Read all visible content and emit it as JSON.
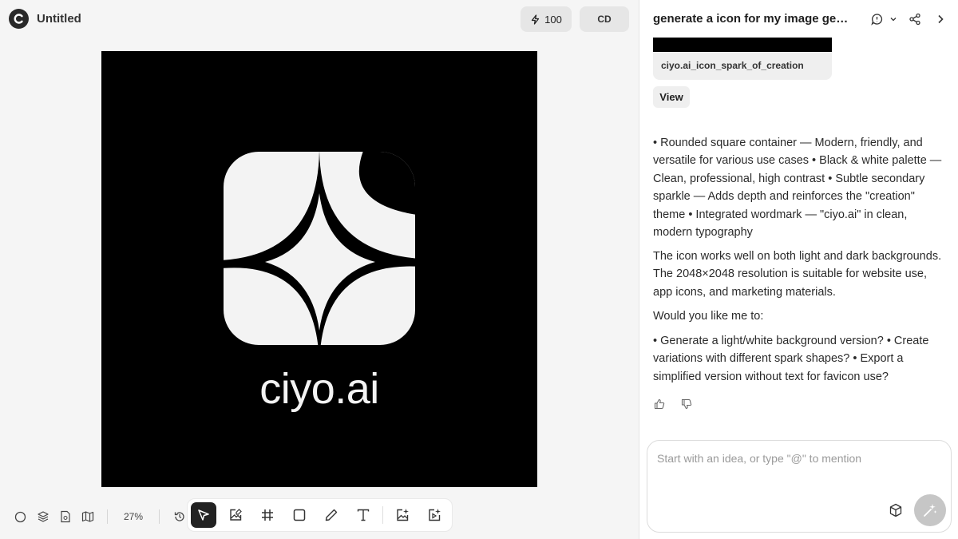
{
  "app": {
    "document_title": "Untitled",
    "credits": "100",
    "user_initials": "CD"
  },
  "canvas": {
    "artwork": {
      "wordmark": "ciyo.ai",
      "background_color": "#000000",
      "foreground_color": "#f3f3f3"
    },
    "zoom": "27%"
  },
  "bottom_left_tools": [
    "circle-icon",
    "layers-icon",
    "page-icon",
    "map-icon"
  ],
  "toolbar": {
    "tools": [
      {
        "name": "select-tool",
        "icon": "cursor-icon",
        "active": true
      },
      {
        "name": "image-tool",
        "icon": "image-edit-icon"
      },
      {
        "name": "frame-tool",
        "icon": "hash-icon"
      },
      {
        "name": "rectangle-tool",
        "icon": "square-icon"
      },
      {
        "name": "pen-tool",
        "icon": "pencil-icon"
      },
      {
        "name": "text-tool",
        "icon": "text-icon"
      },
      {
        "name": "ai-image-tool",
        "icon": "sparkle-image-icon"
      },
      {
        "name": "ai-video-tool",
        "icon": "sparkle-video-icon"
      }
    ]
  },
  "chat": {
    "title": "generate a icon for my image generator",
    "attachment": {
      "filename": "ciyo.ai_icon_spark_of_creation",
      "view_label": "View"
    },
    "messages": [
      "• Rounded square container — Modern, friendly, and versatile for various use cases • Black & white palette — Clean, professional, high contrast • Subtle secondary sparkle — Adds depth and reinforces the \"creation\" theme • Integrated wordmark — \"ciyo.ai\" in clean, modern typography",
      "The icon works well on both light and dark backgrounds. The 2048×2048 resolution is suitable for website use, app icons, and marketing materials.",
      "Would you like me to:",
      "• Generate a light/white background version? • Create variations with different spark shapes? • Export a simplified version without text for favicon use?"
    ],
    "composer_placeholder": "Start with an idea, or type \"@\" to mention"
  }
}
